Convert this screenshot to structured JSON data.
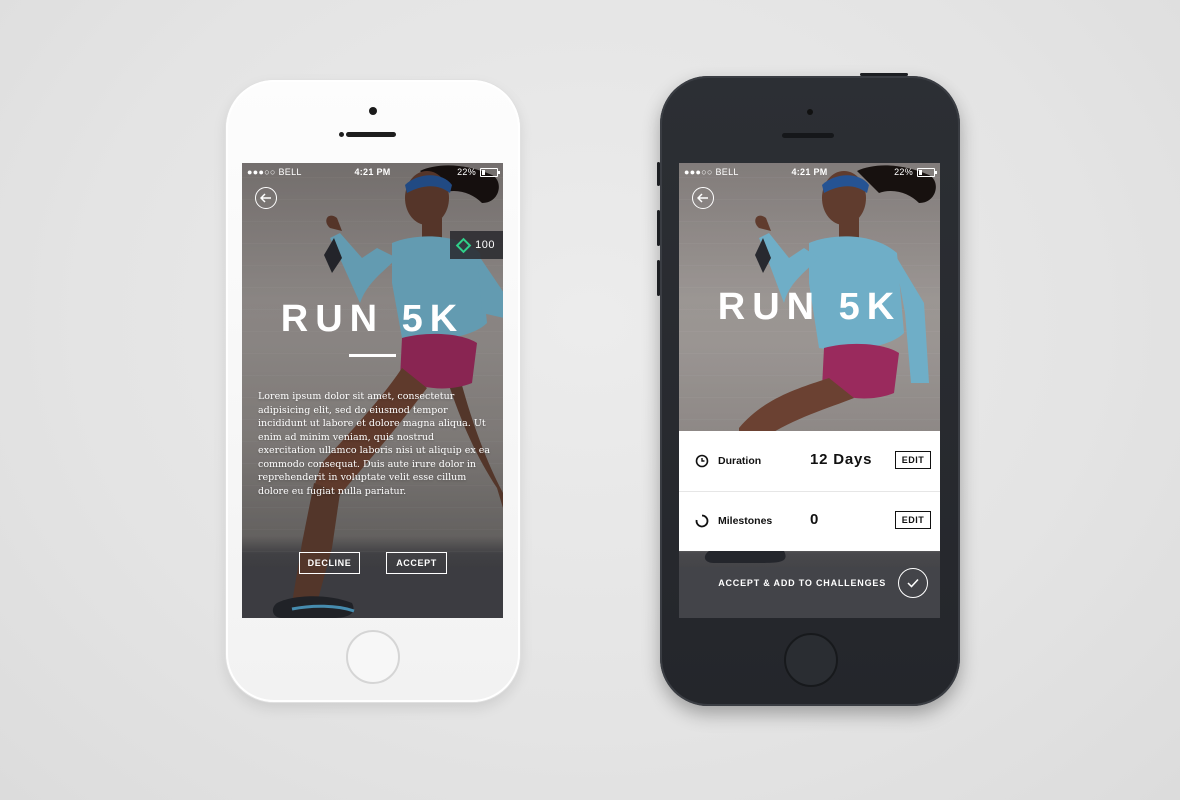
{
  "status": {
    "carrier": "●●●○○ BELL",
    "time": "4:21 PM",
    "battery": "22%"
  },
  "left_screen": {
    "title": "RUN 5K",
    "points": "100",
    "description": "Lorem ipsum dolor sit amet, consectetur adipisicing elit, sed do eiusmod tempor incididunt ut labore et dolore magna aliqua. Ut enim ad minim veniam, quis nostrud exercitation ullamco laboris nisi ut aliquip ex ea commodo consequat. Duis aute irure dolor in reprehenderit in voluptate velit esse cillum dolore eu fugiat nulla pariatur.",
    "decline_label": "DECLINE",
    "accept_label": "ACCEPT"
  },
  "right_screen": {
    "title": "RUN 5K",
    "rows": [
      {
        "label": "Duration",
        "value": "12 Days",
        "edit_label": "EDIT"
      },
      {
        "label": "Milestones",
        "value": "0",
        "edit_label": "EDIT"
      }
    ],
    "accept_label": "ACCEPT & ADD TO CHALLENGES"
  },
  "colors": {
    "accent_points": "#2fd08a",
    "shirt": "#7fc7e3",
    "shorts": "#b0306a",
    "phone_dark": "#2a2d32"
  }
}
